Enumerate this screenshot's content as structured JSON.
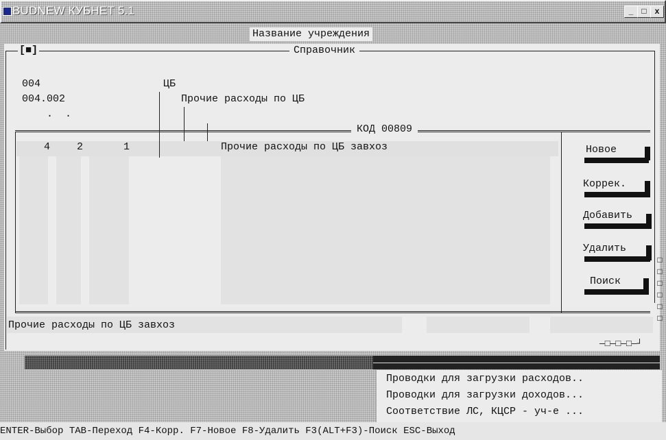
{
  "window": {
    "title": "BUDNEW КУБНЕТ 5.1",
    "controls": {
      "minimize": "_",
      "maximize": "□",
      "close": "x"
    }
  },
  "header": {
    "institution_label": "Название учреждения"
  },
  "dialog": {
    "close_marker": "[■]",
    "title": "Справочник",
    "tree": {
      "level1_code": "004",
      "level1_name": "ЦБ",
      "level2_code": "004.002",
      "level2_name": "Прочие расходы по ЦБ",
      "dots": ".  ."
    },
    "code_label": "КОД 00809",
    "row": {
      "c1": "4",
      "c2": "2",
      "c3": "1",
      "name": "Прочие расходы по ЦБ завхоз"
    },
    "buttons": {
      "new": "Новое",
      "edit": "Коррек.",
      "add": "Добавить",
      "delete": "Удалить",
      "search": "Поиск"
    },
    "footer_text": "Прочие расходы по ЦБ завхоз",
    "corner_decor": "—□—□—□—┘"
  },
  "side_markers": [
    "□",
    "□",
    "□",
    "□",
    "□",
    "□"
  ],
  "menu": {
    "items": [
      "Проводки для загрузки расходов..",
      "Проводки для загрузки доходов...",
      "Соответствие ЛС, КЦСР - уч-е ..."
    ]
  },
  "statusbar": {
    "text": "ENTER-Выбор TAB-Переход F4-Корр. F7-Новое F8-Удалить F3(ALT+F3)-Поиск ESC-Выход"
  }
}
